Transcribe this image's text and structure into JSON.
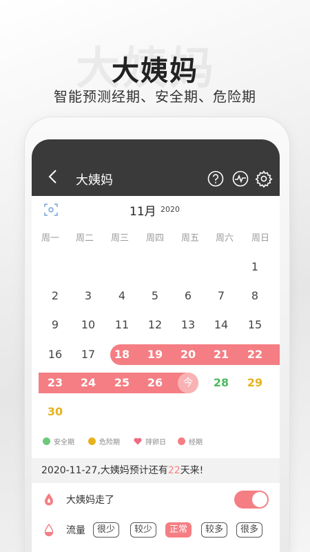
{
  "hero": {
    "title": "大姨妈",
    "watermark": "大姨妈",
    "subtitle": "智能预测经期、安全期、危险期"
  },
  "header": {
    "title": "大姨妈",
    "icons": [
      "back-icon",
      "help-icon",
      "chart-icon",
      "gear-icon"
    ]
  },
  "calendar": {
    "month": "11月",
    "year": "2020",
    "weekdays": [
      "周一",
      "周二",
      "周三",
      "周四",
      "周五",
      "周六",
      "周日"
    ],
    "days": [
      "1",
      "2",
      "3",
      "4",
      "5",
      "6",
      "7",
      "8",
      "9",
      "10",
      "11",
      "12",
      "13",
      "14",
      "15",
      "16",
      "17",
      "18",
      "19",
      "20",
      "21",
      "22",
      "23",
      "24",
      "25",
      "26",
      "27",
      "28",
      "29",
      "30"
    ],
    "today_label": "今",
    "colors": {
      "period": "#f47e83",
      "safe": "#4cbb5e",
      "danger": "#e8b21e",
      "today": "#f9b2b4"
    }
  },
  "legend": [
    {
      "label": "安全期",
      "color": "#6cc97a"
    },
    {
      "label": "危险期",
      "color": "#e8b21e"
    },
    {
      "label": "排卵日",
      "color": "#f06a84"
    },
    {
      "label": "经期",
      "color": "#f47e83"
    }
  ],
  "info": {
    "prefix": "2020-11-27,大姨妈预计还有",
    "days": "22",
    "suffix": "天来!"
  },
  "period_toggle": {
    "label": "大姨妈走了",
    "on": true
  },
  "flow": {
    "label": "流量",
    "options": [
      "很少",
      "较少",
      "正常",
      "较多",
      "很多"
    ],
    "selected": "正常"
  }
}
